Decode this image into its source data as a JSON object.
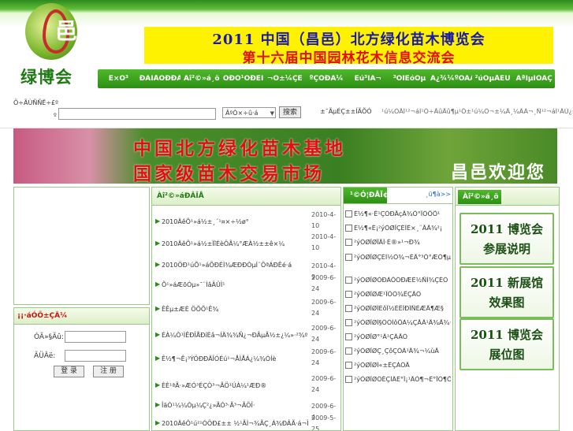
{
  "header": {
    "logo_glyph": "邑",
    "logo_name": "绿博会",
    "banner_line1": "2011 中国（昌邑）北方绿化苗木博览会",
    "banner_line2": "第十六届中国园林花木信息交流会"
  },
  "nav": {
    "items": [
      "Ê×Ò³",
      "ÐÂÎÅÖÐÐÄ",
      "Àî²©»á¸ö",
      "ÕÐÕ¹ÕÐÉÌ",
      "¬Ô±¼ÇÉ",
      "ºÇÓÐÂ¼",
      "Éú³ÌÃ¬",
      "³ÖÏÉóÒµ",
      "Ã¿¾¼ºÔÃÀ",
      "²úÒµÅÉÙ",
      "ÁªÏµÎÒÃÇ"
    ]
  },
  "search": {
    "label_line1": "Ö÷ÃÙÑÑË÷£º",
    "label_line2": "º",
    "select_value": "ÂºÒ×÷û·á",
    "button_label": "搜索",
    "hot_label": "±¯ÃµÉÇ±±ÍÃÕÓ",
    "hot_links": "¹ú¼ÒÃÍ¹²¬áÌ¹Ö÷ÃûÃû¶µ¹Ô±¹ú¼Ò¬±¼Ã¸¼ÂÀ¬¸Ñ¹²¬áÌ¹ÄÚ¿·ÃûÃÏ"
  },
  "photo": {
    "line1": "中国北方绿化苗木基地",
    "line2": "国家级苗木交易市场",
    "line3": "昌邑欢迎您"
  },
  "login": {
    "title": "¡¡·áÓÕ±ÇÂ¼",
    "user_label": "ÓÃ»§Ãû:",
    "pass_label": "ÃÜÂë:",
    "login_button": "登 录",
    "register_button": "注 册"
  },
  "news": {
    "title": "Àî²©»áÐÂÎÅ",
    "items": [
      {
        "title": "2010ÄêÕ¹»á½±¸´¹¤×÷½ø°",
        "date": "2010-4-10"
      },
      {
        "title": "2010ÄêÕ¹»á½±ÏîÉèÖÃ¼°ÆÀ½±±ê×¼",
        "date": "2010-4-10"
      },
      {
        "title": "2010ÖÐ¹úÕ¹»áÕÐÉÌ¾ÆÐÐÒµÍ¨ÖªÁÐÊé·á",
        "date": "2010-4-9"
      },
      {
        "title": "Õ¹»áÆõÓµ»¯¨ÌâÂÛÌ¹",
        "date": "2009-6-24"
      },
      {
        "title": "ÊÊµ±ÆÈ ÖÕÕ¹Ê¾",
        "date": "2009-6-24"
      },
      {
        "title": "ÉÀ¼Ò¹ÌÊÐÎÅÐíÈâ¬ÍÄ¾¾Ñ¿¬ÐÂµÃ½±¿¼»·²¾º±£»°ºÍµ¹¶",
        "date": "2009-6-24"
      },
      {
        "title": "Ê½¶¬Ê¡³ÝÖÐÐÄÎÓÉú¹¬ÅÌÅÁ¿¼¾ÓÍè",
        "date": "2009-6-24"
      },
      {
        "title": "ÈÈ¹ªÃ·»ÆÓ³ÉÇÒ³¬ÃÖ¹ÚÀ¼¹ÆÐ®",
        "date": "2009-6-24"
      },
      {
        "title": "ÎäÒ¹¼¼Òµ¼Ç²¿»ÃÓ³·Ã³¬ÃÖÎ·",
        "date": "2009-6-4"
      },
      {
        "title": "2010ÄêÔ¹ú²¹ÓÖÐ£±± ½¹ÃÌ¬¾ÃÇ¸Á¾ÐÂÃ·á¬ÎÓ",
        "date": "2009-5-25"
      }
    ]
  },
  "supply": {
    "tab_label": "¹©Ó¦ÐÅÏ¢",
    "more_label": "¸ü¶à>>",
    "items": [
      "É½¶«·Ê¹ÇÓÐÃçÄ¾Ô°ÏÖÕÕ¹",
      "É½¶«Ê¡²ýÒØÏÇÊÎÊ×¸¨ÃÃ¾²¡",
      "²ýÒØÏØÏÃÎ·É®»¹¬Ð¾",
      "²ýÒØÏØÇÈÌ½Ó¾¬ÈÄ°³Ó°ÆÖ¶µ°¿¹¹ú¾ÊÎ",
      "²ýÒØÏØÓÐÀÔÖÐÆÈ½ÑÌ¾ÇÈÓ",
      "²ýÒØÏØÆ¹ÏÔÓ¾ÊÇÃÓ",
      "²ýÒØÏØÎÉôÏ½ÈËÎÐÎÑÈÆÄ¶Æ§",
      "²ýÒØÏØÌ§ÖÓÌôÔÀ¼ÇÃÂ¹Ä¾Ä¾¬¼ùÃ",
      "²ýÒØÏØ°¹Â¹ÇÂÃÓ",
      "²ýÒØÏØÇ¸ÇôÇÓÂ¹Ä¾¬¼ùÃ",
      "²ýÒØÏØÌ«±ÊÇÁÖÃ",
      "²ýÒØÏØÖÊÇÍÂÊ°Ï¡¹ÃÓ¶¬Ê°ÏÖ¶Õ¹"
    ]
  },
  "expo": {
    "tab_label": "Àî²©»á¸ö",
    "cards": [
      {
        "l1": "2011 博览会",
        "l2": "参展说明"
      },
      {
        "l1": "2011 新展馆",
        "l2": "效果图"
      },
      {
        "l1": "2011 博览会",
        "l2": "展位图"
      }
    ]
  }
}
